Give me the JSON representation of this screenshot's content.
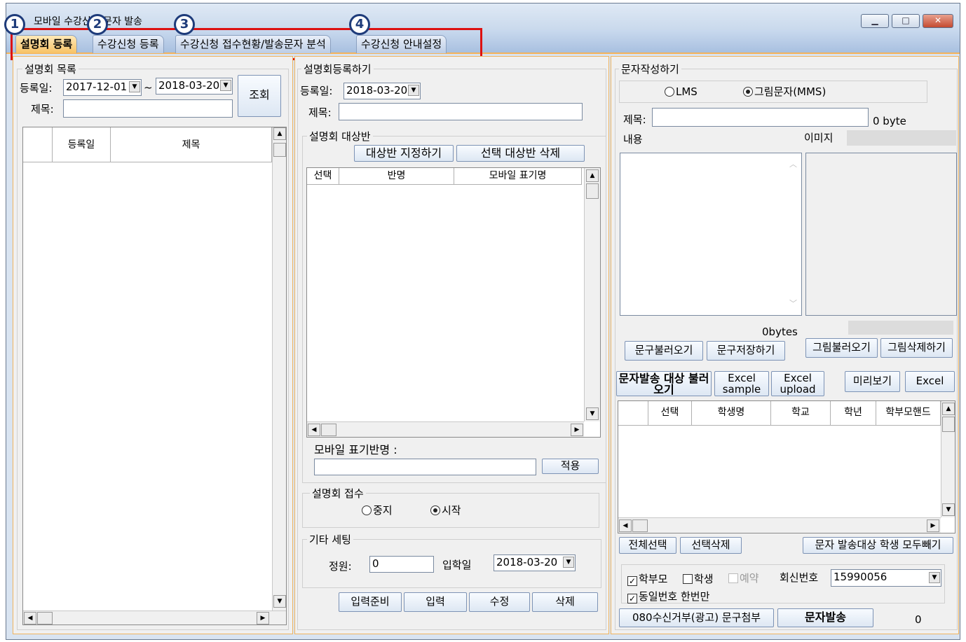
{
  "window": {
    "title": "모바일 수강신청 문자 발송",
    "min_label": "▁",
    "max_label": "□",
    "close_label": "✕"
  },
  "badges": [
    "1",
    "2",
    "3",
    "4"
  ],
  "tabs": [
    "설명회 등록",
    "수강신청 등록",
    "수강신청 접수현황/발송문자 분석",
    "수강신청 안내설정"
  ],
  "left": {
    "group_title": "설명회 목록",
    "date_label": "등록일:",
    "date_from": "2017-12-01",
    "date_sep": "~",
    "date_to": "2018-03-20",
    "search_button": "조회",
    "title_label": "제목:",
    "title_value": "",
    "columns": [
      "등록일",
      "제목"
    ]
  },
  "middle": {
    "group_title": "설명회등록하기",
    "date_label": "등록일:",
    "date_value": "2018-03-20",
    "title_label": "제목:",
    "title_value": "",
    "target_group_title": "설명회 대상반",
    "assign_button": "대상반 지정하기",
    "delete_button": "선택 대상반 삭제",
    "columns": [
      "선택",
      "반명",
      "모바일 표기명"
    ],
    "mobile_label": "모바일 표기반명 :",
    "mobile_value": "",
    "apply_button": "적용",
    "reception_title": "설명회 접수",
    "stop_label": "중지",
    "start_label": "시작",
    "etc_title": "기타 세팅",
    "capacity_label": "정원:",
    "capacity_value": "0",
    "entry_label": "입학일",
    "entry_value": "2018-03-20",
    "prepare_button": "입력준비",
    "input_button": "입력",
    "edit_button": "수정",
    "remove_button": "삭제"
  },
  "right": {
    "group_title": "문자작성하기",
    "lms_label": "LMS",
    "mms_label": "그림문자(MMS)",
    "title_label": "제목:",
    "title_value": "",
    "byte_label": "0 byte",
    "content_label": "내용",
    "image_label": "이미지",
    "bytes_count": "0bytes",
    "load_phrase_button": "문구불러오기",
    "save_phrase_button": "문구저장하기",
    "load_image_button": "그림불러오기",
    "delete_image_button": "그림삭제하기",
    "load_targets_button": "문자발송 대상 불러오기",
    "excel_sample_button": "Excel sample",
    "excel_upload_button": "Excel upload",
    "preview_button": "미리보기",
    "excel_button": "Excel",
    "columns": [
      "선택",
      "학생명",
      "학교",
      "학년",
      "학부모핸드"
    ],
    "select_all_button": "전체선택",
    "delete_selected_button": "선택삭제",
    "remove_all_button": "문자 발송대상 학생 모두빼기",
    "parent_label": "학부모",
    "student_label": "학생",
    "reserve_label": "예약",
    "callback_label": "회신번호",
    "callback_value": "15990056",
    "same_number_label": "동일번호 한번만",
    "optout_button": "080수신거부(광고) 문구첨부",
    "send_button": "문자발송",
    "send_count": "0"
  },
  "colors": {
    "accent": "#f5b35a",
    "highlight": "#d11111",
    "badge": "#1e3b7a"
  }
}
